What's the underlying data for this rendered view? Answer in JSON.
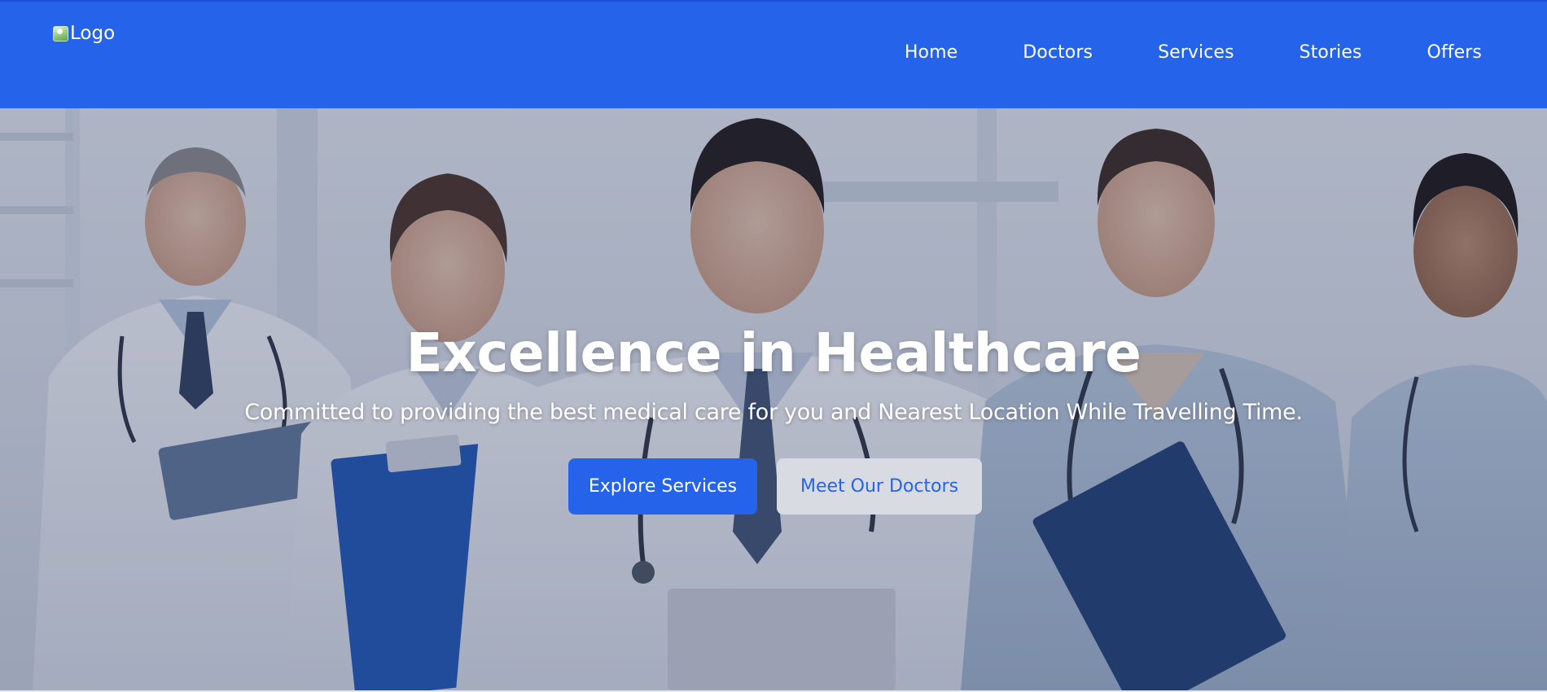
{
  "header": {
    "logo_alt": "Logo",
    "nav": [
      {
        "label": "Home"
      },
      {
        "label": "Doctors"
      },
      {
        "label": "Services"
      },
      {
        "label": "Stories"
      },
      {
        "label": "Offers"
      }
    ]
  },
  "hero": {
    "title": "Excellence in Healthcare",
    "subtitle": "Committed to providing the best medical care for you and Nearest Location While Travelling Time.",
    "primary_button": "Explore Services",
    "secondary_button": "Meet Our Doctors"
  },
  "colors": {
    "brand_blue": "#2563eb",
    "secondary_button_bg": "#d9dbe3",
    "white": "#ffffff"
  }
}
